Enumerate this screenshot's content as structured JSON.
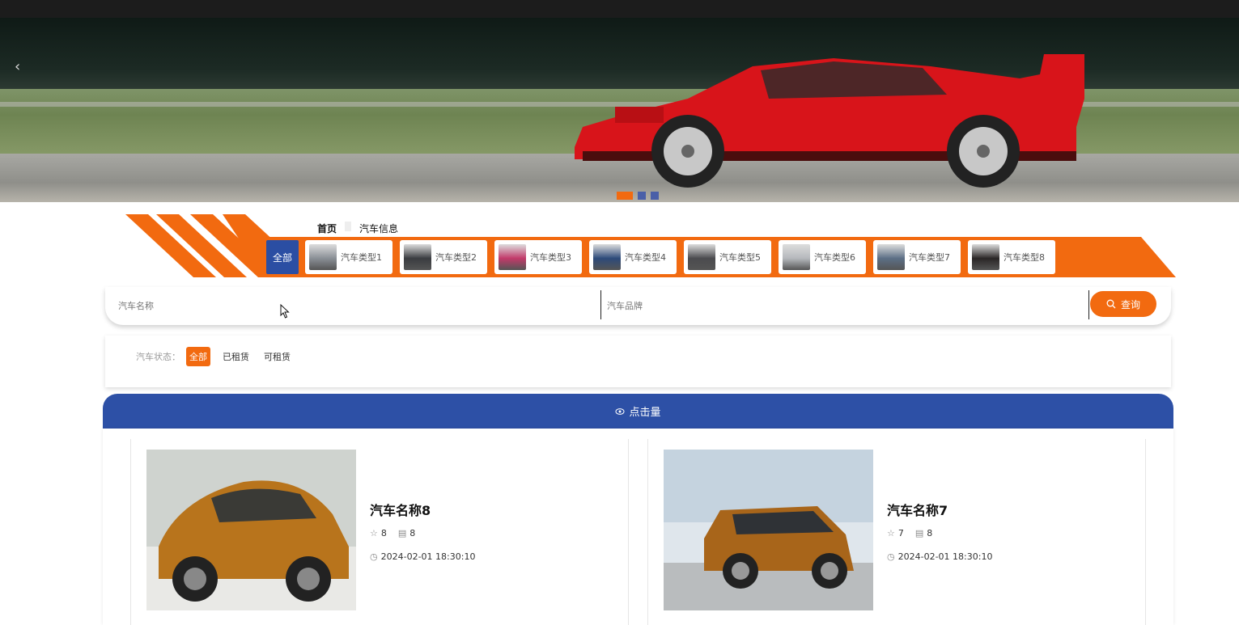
{
  "banner": {
    "prev_icon": "chevron-left-icon",
    "prev_glyph": "‹",
    "slides": 3,
    "active_slide": 1
  },
  "breadcrumb": {
    "home": "首页",
    "current": "汽车信息"
  },
  "categories": {
    "all_label": "全部",
    "items": [
      {
        "label": "汽车类型1",
        "color": "#8a8f96"
      },
      {
        "label": "汽车类型2",
        "color": "#3a3c40"
      },
      {
        "label": "汽车类型3",
        "color": "#c23a6a"
      },
      {
        "label": "汽车类型4",
        "color": "#2d4a7a"
      },
      {
        "label": "汽车类型5",
        "color": "#4b4b4e"
      },
      {
        "label": "汽车类型6",
        "color": "#b5b8bc"
      },
      {
        "label": "汽车类型7",
        "color": "#5c6f86"
      },
      {
        "label": "汽车类型8",
        "color": "#2a2626"
      }
    ]
  },
  "search": {
    "name_placeholder": "汽车名称",
    "brand_placeholder": "汽车品牌",
    "button_label": "查询",
    "button_icon": "search-icon"
  },
  "filter": {
    "label": "汽车状态：",
    "options": [
      "全部",
      "已租赁",
      "可租赁"
    ],
    "selected": "全部"
  },
  "panel": {
    "title": "点击量",
    "title_icon": "eye-icon"
  },
  "cars": [
    {
      "name": "汽车名称8",
      "likes": "8",
      "comments": "8",
      "time": "2024-02-01 18:30:10",
      "body_color": "#b8741c"
    },
    {
      "name": "汽车名称7",
      "likes": "7",
      "comments": "8",
      "time": "2024-02-01 18:30:10",
      "body_color": "#a8651a"
    }
  ],
  "colors": {
    "accent": "#f26a10",
    "primary": "#2d50a6"
  }
}
